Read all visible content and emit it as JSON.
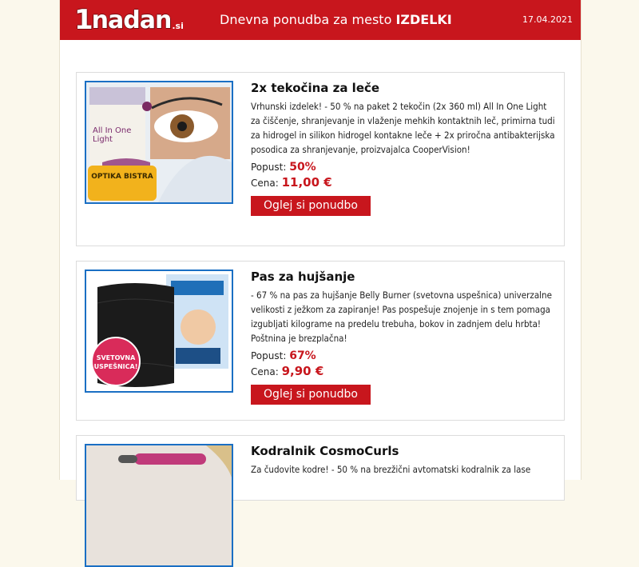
{
  "header": {
    "logo_num": "1",
    "logo_word": "nadan",
    "logo_tld": ".si",
    "title_prefix": "Dnevna ponudba za mesto ",
    "title_city": "IZDELKI",
    "date": "17.04.2021"
  },
  "labels": {
    "discount": "Popust:",
    "price": "Cena:"
  },
  "offers": [
    {
      "title": "2x tekočina za leče",
      "description": "Vrhunski izdelek! - 50 % na paket 2 tekočin (2x 360 ml) All In One Light za čiščenje, shranjevanje in vlaženje mehkih kontaktnih leč, primirna tudi za hidrogel in silikon hidrogel kontakne leče + 2x priročna antibakterijska posodica za shranjevanje, proizvajalca CooperVision!",
      "discount": "50%",
      "price": "11,00 €",
      "button": "Oglej si ponudbo",
      "image_text": "All In One Light",
      "image_badge": "OPTIKA BISTRA"
    },
    {
      "title": "Pas za hujšanje",
      "description": "- 67 % na pas za hujšanje Belly Burner (svetovna uspešnica) univerzalne velikosti z ježkom za zapiranje! Pas pospešuje znojenje in s tem pomaga izgubljati kilograme na predelu trebuha, bokov in zadnjem delu hrbta! Poštnina je brezplačna!",
      "discount": "67%",
      "price": "9,90 €",
      "button": "Oglej si ponudbo",
      "image_badge": "SVETOVNA USPEŠNICA!"
    },
    {
      "title": "Kodralnik CosmoCurls",
      "description": "Za čudovite kodre! - 50 % na brezžični avtomatski kodralnik za lase"
    }
  ],
  "colors": {
    "brand_red": "#c8161d",
    "image_border": "#1a6fc4"
  }
}
